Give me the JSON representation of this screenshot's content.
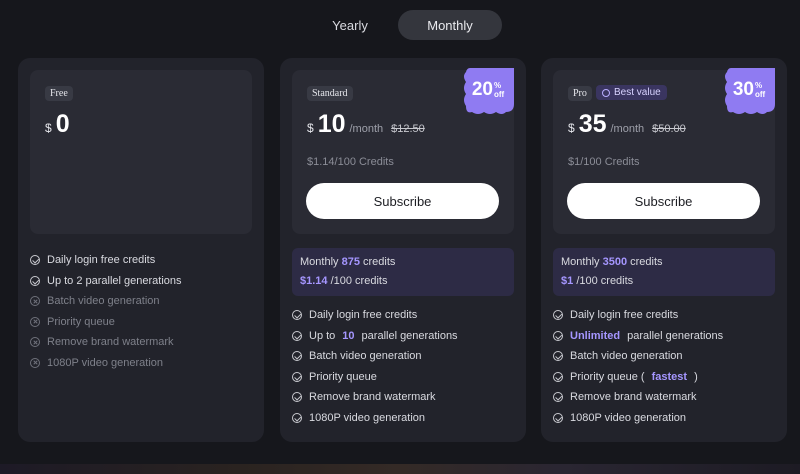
{
  "toggle": {
    "yearly": "Yearly",
    "monthly": "Monthly",
    "selected": "Monthly"
  },
  "colors": {
    "accent": "#a596ff",
    "badge": "#8f7bf2",
    "background": "#16171c"
  },
  "plans": {
    "free": {
      "tag": "Free",
      "currency": "$",
      "price": "0",
      "features": [
        {
          "text": "Daily login free credits",
          "included": true
        },
        {
          "text": "Up to 2 parallel generations",
          "included": true
        },
        {
          "text": "Batch video generation",
          "included": false
        },
        {
          "text": "Priority queue",
          "included": false
        },
        {
          "text": "Remove brand watermark",
          "included": false
        },
        {
          "text": "1080P video generation",
          "included": false
        }
      ]
    },
    "standard": {
      "tag": "Standard",
      "currency": "$",
      "price": "10",
      "period": "/month",
      "old_price": "$12.50",
      "credits_rate": "$1.14/100 Credits",
      "subscribe": "Subscribe",
      "badge": {
        "num": "20",
        "pct": "%",
        "off": "off"
      },
      "monthly_prefix": "Monthly",
      "monthly_credits": "875",
      "monthly_suffix": "credits",
      "rate_highlight": "$1.14",
      "rate_suffix": "/100 credits",
      "features": {
        "f1": "Daily login free credits",
        "f2_pre": "Up to",
        "f2_hl": "10",
        "f2_post": "parallel generations",
        "f3": "Batch video generation",
        "f4": "Priority queue",
        "f5": "Remove brand watermark",
        "f6": "1080P video generation"
      }
    },
    "pro": {
      "tag": "Pro",
      "best_value": "Best value",
      "currency": "$",
      "price": "35",
      "period": "/month",
      "old_price": "$50.00",
      "credits_rate": "$1/100 Credits",
      "subscribe": "Subscribe",
      "badge": {
        "num": "30",
        "pct": "%",
        "off": "off"
      },
      "monthly_prefix": "Monthly",
      "monthly_credits": "3500",
      "monthly_suffix": "credits",
      "rate_highlight": "$1",
      "rate_suffix": "/100 credits",
      "features": {
        "f1": "Daily login free credits",
        "f2_hl": "Unlimited",
        "f2_post": "parallel generations",
        "f3": "Batch video generation",
        "f4_pre": "Priority queue (",
        "f4_hl": "fastest",
        "f4_post": ")",
        "f5": "Remove brand watermark",
        "f6": "1080P video generation"
      }
    }
  }
}
